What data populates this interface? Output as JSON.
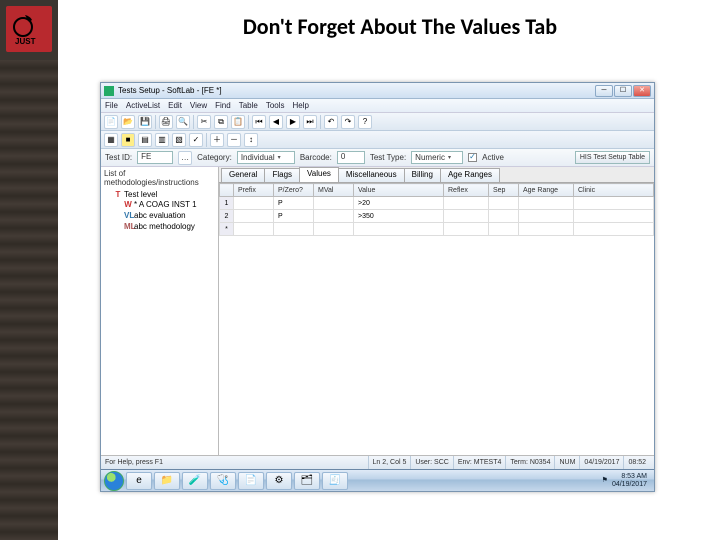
{
  "slide": {
    "title": "Don't  Forget About The Values Tab"
  },
  "logo_text": "JUST",
  "window": {
    "title": "Tests Setup - SoftLab - [FE *]"
  },
  "menu": [
    "File",
    "ActiveList",
    "Edit",
    "View",
    "Find",
    "Table",
    "Tools",
    "Help"
  ],
  "filter": {
    "test_id_label": "Test ID:",
    "test_id_value": "FE",
    "category_label": "Category:",
    "category_value": "Individual",
    "barcode_label": "Barcode:",
    "barcode_value": "0",
    "test_type_label": "Test Type:",
    "test_type_value": "Numeric",
    "active_label": "Active",
    "his_button": "HIS Test Setup Table"
  },
  "left": {
    "caption": "List of methodologies/instructions",
    "nodes": [
      {
        "icon": "T",
        "label": "Test level"
      },
      {
        "icon": "W",
        "label": "* A COAG INST 1"
      },
      {
        "icon": "VL",
        "label": "abc evaluation"
      },
      {
        "icon": "ML",
        "label": "abc methodology"
      }
    ]
  },
  "tabs": [
    "General",
    "Flags",
    "Values",
    "Miscellaneous",
    "Billing",
    "Age Ranges"
  ],
  "active_tab": 2,
  "grid": {
    "cols": [
      "Prefix",
      "P/Zero?",
      "MVal",
      "Value",
      "Reflex",
      "Sep",
      "Age Range",
      "Clinic"
    ],
    "rows": [
      {
        "n": "1",
        "prefix": "",
        "pzero": "P",
        "mval": "",
        "value": ">20",
        "reflex": "",
        "sep": "",
        "age": "",
        "clinic": ""
      },
      {
        "n": "2",
        "prefix": "",
        "pzero": "P",
        "mval": "",
        "value": ">350",
        "reflex": "",
        "sep": "",
        "age": "",
        "clinic": ""
      }
    ]
  },
  "status": {
    "help": "For Help, press F1",
    "pos": "Ln 2, Col 5",
    "user": "User: SCC",
    "env": "Env: MTEST4",
    "term": "Term: N0354",
    "num": "NUM",
    "date": "04/19/2017",
    "time": "08:52"
  },
  "taskbar": {
    "time": "8:53 AM",
    "date": "04/19/2017"
  }
}
